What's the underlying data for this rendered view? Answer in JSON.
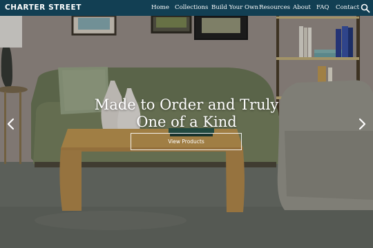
{
  "brand": "CHARTER STREET",
  "nav": [
    "Home",
    "Collections",
    "Build Your Own",
    "Resources",
    "About",
    "FAQ",
    "Contact"
  ],
  "hero": {
    "line1": "Made to Order and Truly",
    "line2": "One of a Kind",
    "cta_label": "View Products"
  },
  "icons": {
    "search": "search-icon",
    "prev": "chevron-left-icon",
    "next": "chevron-right-icon"
  },
  "colors": {
    "navbar": "#123f53",
    "text": "#ffffff"
  }
}
